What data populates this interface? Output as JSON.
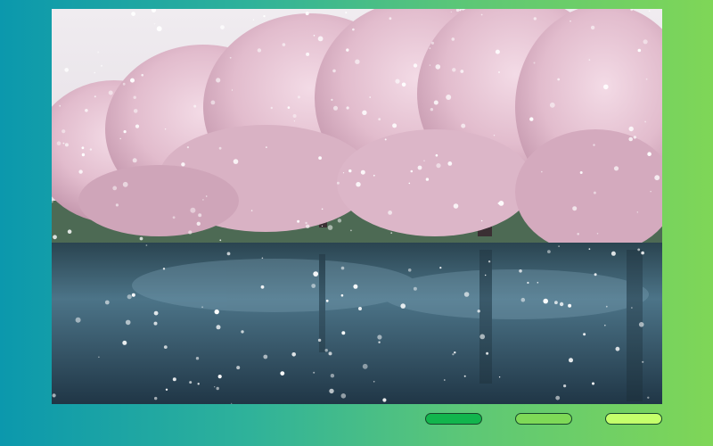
{
  "photo": {
    "subject": "cherry-blossom-trees-in-snow-by-water",
    "colors": {
      "sky": "#e9e4ea",
      "blossom": "#e6c3d4",
      "blossom_dark": "#b98ca3",
      "water": "#3c5d70",
      "water_dark": "#1f3547",
      "snow": "#ffffff"
    }
  },
  "controls": {
    "buttons": [
      {
        "color": "#12b54d"
      },
      {
        "color": "#7ed957"
      },
      {
        "color": "#c4ff6b"
      }
    ]
  }
}
